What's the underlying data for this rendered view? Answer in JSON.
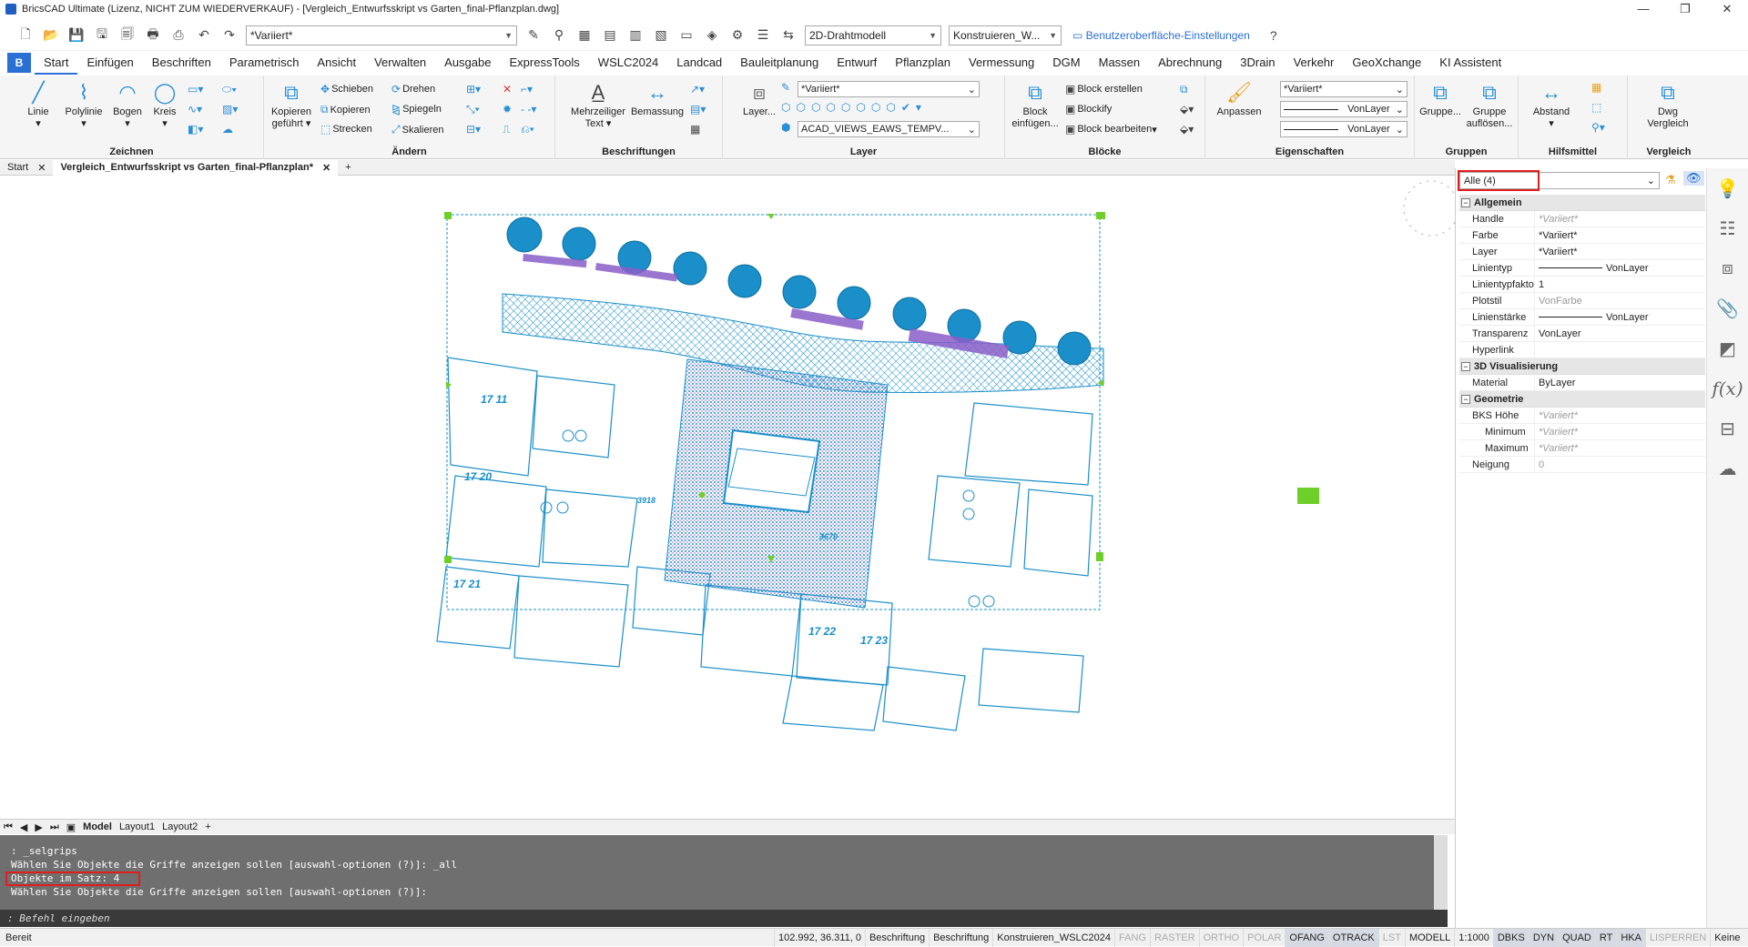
{
  "title": "BricsCAD Ultimate (Lizenz, NICHT ZUM WIEDERVERKAUF) - [Vergleich_Entwurfsskript vs Garten_final-Pflanzplan.dwg]",
  "window": {
    "minimize": "—",
    "restore": "❐",
    "close": "✕"
  },
  "qat": {
    "layer_select": "*Variiert*",
    "visual_style": "2D-Drahtmodell",
    "workspace": "Konstruieren_W...",
    "ui_settings": "Benutzeroberfläche-Einstellungen"
  },
  "tabs": [
    "Start",
    "Einfügen",
    "Beschriften",
    "Parametrisch",
    "Ansicht",
    "Verwalten",
    "Ausgabe",
    "ExpressTools",
    "WSLC2024",
    "Landcad",
    "Bauleitplanung",
    "Entwurf",
    "Pflanzplan",
    "Vermessung",
    "DGM",
    "Massen",
    "Abrechnung",
    "3Drain",
    "Verkehr",
    "GeoXchange",
    "KI Assistent"
  ],
  "ribbon": {
    "zeichnen": {
      "title": "Zeichnen",
      "linie": "Linie",
      "polylinie": "Polylinie",
      "bogen": "Bogen",
      "kreis": "Kreis"
    },
    "aendern": {
      "title": "Ändern",
      "kopieren_gefuehrt": "Kopieren geführt",
      "schieben": "Schieben",
      "kopieren": "Kopieren",
      "strecken": "Strecken",
      "drehen": "Drehen",
      "spiegeln": "Spiegeln",
      "skalieren": "Skalieren"
    },
    "beschriftungen": {
      "title": "Beschriftungen",
      "mtext": "Mehrzeiliger Text",
      "bemassung": "Bemassung"
    },
    "layer": {
      "title": "Layer",
      "layer_btn": "Layer...",
      "layer_sel": "*Variiert*",
      "layer_sel2": "ACAD_VIEWS_EAWS_TEMPV..."
    },
    "bloecke": {
      "title": "Blöcke",
      "block_einfuegen": "Block einfügen...",
      "block_erstellen": "Block erstellen",
      "blockify": "Blockify",
      "block_bearbeiten": "Block bearbeiten"
    },
    "eigenschaften": {
      "title": "Eigenschaften",
      "anpassen": "Anpassen",
      "color_sel": "*Variiert*",
      "lt1": "VonLayer",
      "lt2": "VonLayer"
    },
    "gruppen": {
      "title": "Gruppen",
      "gruppe": "Gruppe...",
      "aufloesen": "Gruppe auflösen..."
    },
    "hilfsmittel": {
      "title": "Hilfsmittel",
      "abstand": "Abstand"
    },
    "vergleich": {
      "title": "Vergleich",
      "dwg": "Dwg Vergleich"
    }
  },
  "doctabs": {
    "start": "Start",
    "doc": "Vergleich_Entwurfsskript vs Garten_final-Pflanzplan*",
    "plus": "+"
  },
  "layouttabs": [
    "Model",
    "Layout1",
    "Layout2"
  ],
  "plan_labels": [
    "17 11",
    "17 20",
    "17 21",
    "17 22",
    "17 23",
    "3918",
    "3670"
  ],
  "cmd": {
    "lines": [
      ": _selgrips",
      "Wählen Sie Objekte die Griffe anzeigen sollen [auswahl-optionen (?)]: _all",
      "Objekte im Satz: 4",
      "Wählen Sie Objekte die Griffe anzeigen sollen [auswahl-optionen (?)]:"
    ],
    "prompt": ": Befehl eingeben"
  },
  "status": {
    "ready": "Bereit",
    "coords": "102.992, 36.311, 0",
    "items": [
      {
        "t": "Beschriftung",
        "s": "n"
      },
      {
        "t": "Beschriftung",
        "s": "n"
      },
      {
        "t": "Konstruieren_WSLC2024",
        "s": "n"
      },
      {
        "t": "FANG",
        "s": "off"
      },
      {
        "t": "RASTER",
        "s": "off"
      },
      {
        "t": "ORTHO",
        "s": "off"
      },
      {
        "t": "POLAR",
        "s": "off"
      },
      {
        "t": "OFANG",
        "s": "on"
      },
      {
        "t": "OTRACK",
        "s": "on"
      },
      {
        "t": "LST",
        "s": "off"
      },
      {
        "t": "MODELL",
        "s": "n"
      },
      {
        "t": "1:1000",
        "s": "n"
      },
      {
        "t": "DBKS",
        "s": "on"
      },
      {
        "t": "DYN",
        "s": "on"
      },
      {
        "t": "QUAD",
        "s": "on"
      },
      {
        "t": "RT",
        "s": "on"
      },
      {
        "t": "HKA",
        "s": "on"
      },
      {
        "t": "LISPERREN",
        "s": "off"
      },
      {
        "t": "Keine",
        "s": "n"
      }
    ]
  },
  "props": {
    "selection": "Alle (4)",
    "categories": {
      "allgemein": "Allgemein",
      "vis3d": "3D Visualisierung",
      "geometrie": "Geometrie"
    },
    "rows": {
      "handle": {
        "k": "Handle",
        "v": "*Variiert*"
      },
      "farbe": {
        "k": "Farbe",
        "v": "*Variiert*"
      },
      "layer": {
        "k": "Layer",
        "v": "*Variiert*"
      },
      "linientyp": {
        "k": "Linientyp",
        "v": "VonLayer"
      },
      "linientypfaktor": {
        "k": "Linientypfaktor",
        "v": "1"
      },
      "plotstil": {
        "k": "Plotstil",
        "v": "VonFarbe"
      },
      "linienstaerke": {
        "k": "Linienstärke",
        "v": "VonLayer"
      },
      "transparenz": {
        "k": "Transparenz",
        "v": "VonLayer"
      },
      "hyperlink": {
        "k": "Hyperlink",
        "v": ""
      },
      "material": {
        "k": "Material",
        "v": "ByLayer"
      },
      "bks_hoehe": {
        "k": "BKS Höhe",
        "v": "*Variiert*"
      },
      "minimum": {
        "k": "Minimum",
        "v": "*Variiert*"
      },
      "maximum": {
        "k": "Maximum",
        "v": "*Variiert*"
      },
      "neigung": {
        "k": "Neigung",
        "v": "0"
      }
    }
  }
}
